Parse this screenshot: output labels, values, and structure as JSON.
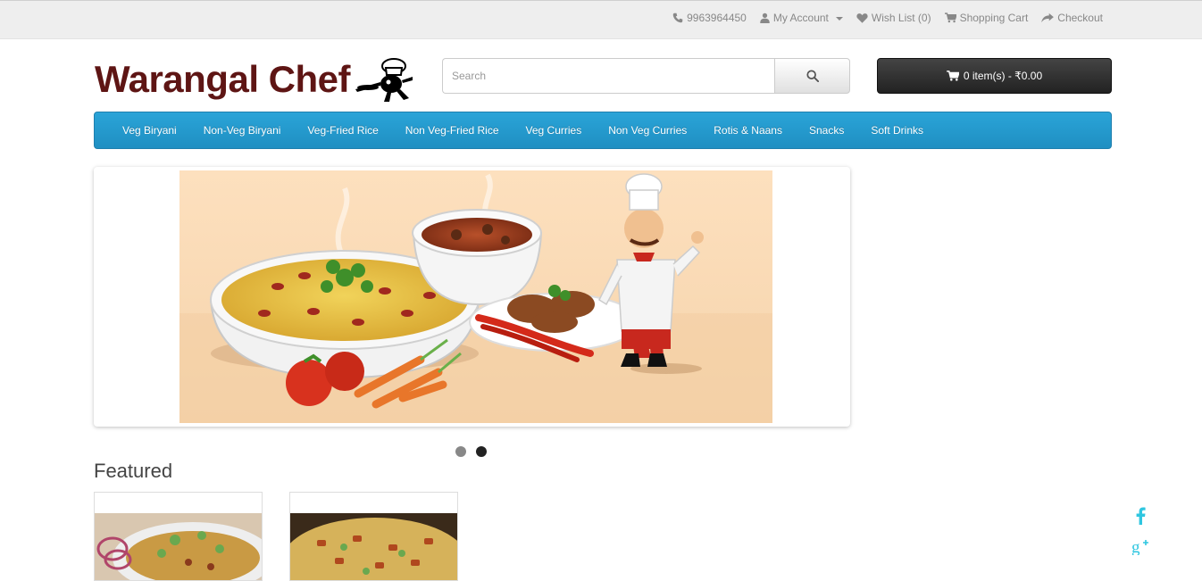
{
  "topbar": {
    "phone": "9963964450",
    "my_account": "My Account",
    "wish_list": "Wish List (0)",
    "shopping_cart": "Shopping Cart",
    "checkout": "Checkout"
  },
  "logo": {
    "text": "Warangal Chef"
  },
  "search": {
    "placeholder": "Search"
  },
  "cart": {
    "label": "0 item(s) - ₹0.00"
  },
  "menu": {
    "items": [
      "Veg Biryani",
      "Non-Veg Biryani",
      "Veg-Fried Rice",
      "Non Veg-Fried Rice",
      "Veg Curries",
      "Non Veg Curries",
      "Rotis & Naans",
      "Snacks",
      "Soft Drinks"
    ]
  },
  "slideshow": {
    "active_dot": 2,
    "dot_count": 2
  },
  "featured": {
    "title": "Featured"
  },
  "colors": {
    "brand": "#5e1514",
    "menu_bg": "#2aa4d8",
    "cart_bg": "#333333",
    "social": "#2fc6e0"
  },
  "icons": {
    "phone": "phone-icon",
    "account": "user-icon",
    "wish": "heart-icon",
    "cart": "cart-icon",
    "checkout": "share-icon",
    "search": "search-icon",
    "facebook": "facebook-icon",
    "google_plus": "google-plus-icon"
  }
}
